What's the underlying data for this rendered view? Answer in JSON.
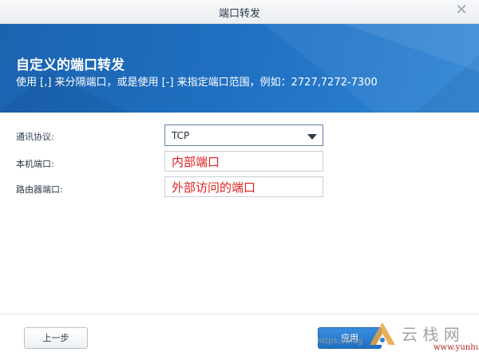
{
  "window": {
    "title": "端口转发",
    "close_symbol": "✕"
  },
  "banner": {
    "title": "自定义的端口转发",
    "description": "使用 [,] 来分隔端口，或是使用 [-] 来指定端口范围，例如：2727,7272-7300"
  },
  "form": {
    "protocol_label": "通讯协议:",
    "protocol_value": "TCP",
    "local_port_label": "本机端口:",
    "local_port_annotation": "内部端口",
    "router_port_label": "路由器端口:",
    "router_port_annotation": "外部访问的端口"
  },
  "footer": {
    "back_label": "上一步",
    "apply_label": "应用"
  },
  "watermark": {
    "url_text": "https://blog",
    "site_text": "www.yunhu.net"
  },
  "colors": {
    "banner_blue": "#1f6fc0",
    "annotation_red": "#e02020",
    "primary_button": "#1f6fc0"
  },
  "icons": {
    "close": "close-icon",
    "dropdown": "dropdown-arrow-icon"
  }
}
